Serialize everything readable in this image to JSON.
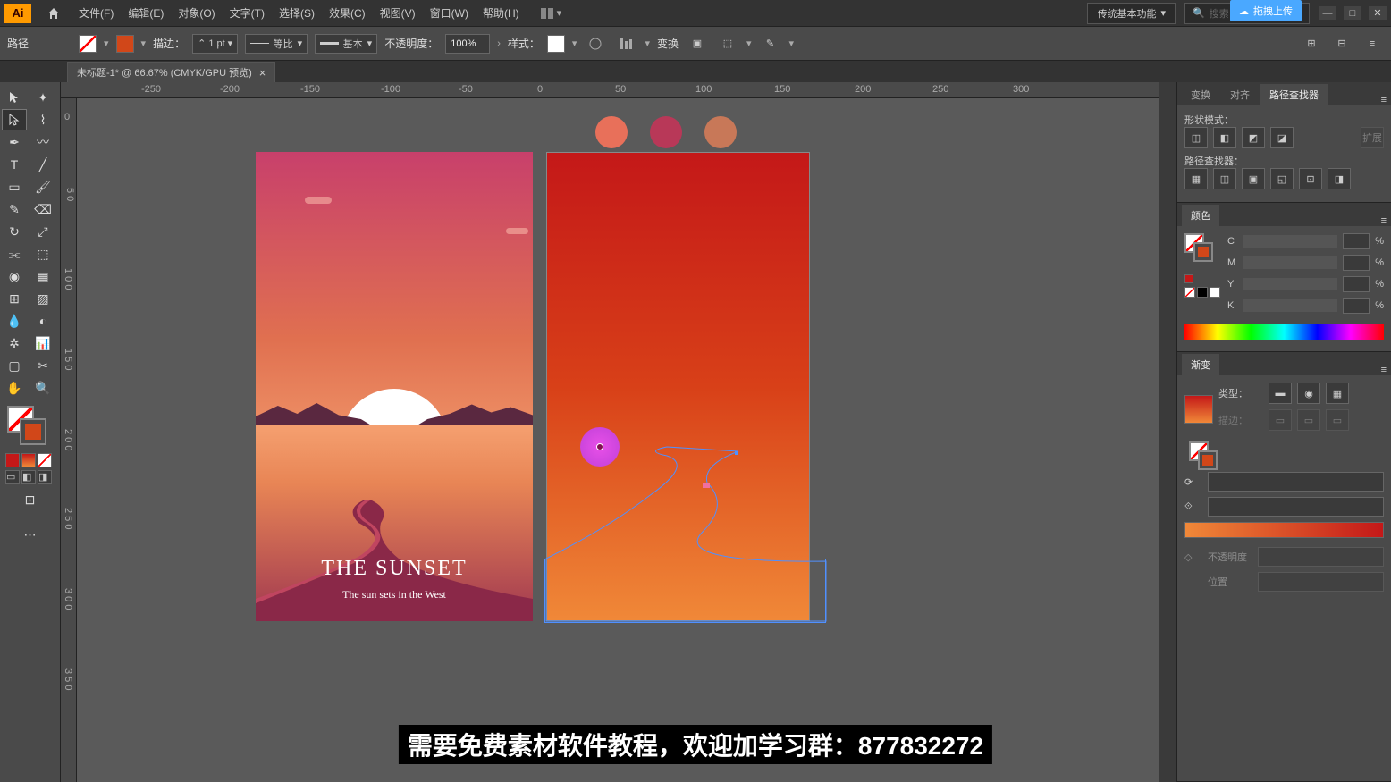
{
  "menubar": {
    "logo": "Ai",
    "items": [
      "文件(F)",
      "编辑(E)",
      "对象(O)",
      "文字(T)",
      "选择(S)",
      "效果(C)",
      "视图(V)",
      "窗口(W)",
      "帮助(H)"
    ],
    "workspace": "传统基本功能",
    "search_placeholder": "搜索 Adobe Stock",
    "upload": "拖拽上传"
  },
  "controlbar": {
    "mode": "路径",
    "stroke_label": "描边：",
    "stroke_weight": "1 pt",
    "profile1": "等比",
    "profile2": "基本",
    "opacity_label": "不透明度：",
    "opacity": "100%",
    "style_label": "样式：",
    "transform_label": "变换"
  },
  "tab": {
    "title": "未标题-1* @ 66.67% (CMYK/GPU 预览)"
  },
  "ruler": {
    "h": [
      "-250",
      "-200",
      "-150",
      "-100",
      "-50",
      "0",
      "50",
      "100",
      "150",
      "200",
      "250",
      "300"
    ],
    "v": [
      "0",
      "5 0",
      "1 0 0",
      "1 5 0",
      "2 0 0",
      "2 5 0",
      "3 0 0",
      "3 5 0"
    ]
  },
  "artboard1": {
    "title": "THE SUNSET",
    "subtitle": "The sun sets in the West"
  },
  "color_dots": [
    "#e8705a",
    "#b83858",
    "#c87858"
  ],
  "panels": {
    "align": {
      "tabs": [
        "变换",
        "对齐",
        "路径查找器"
      ],
      "shape_mode": "形状模式：",
      "pathfinder": "路径查找器："
    },
    "color": {
      "title": "颜色",
      "channels": [
        "C",
        "M",
        "Y",
        "K"
      ],
      "pct": "%"
    },
    "gradient": {
      "title": "渐变",
      "type_label": "类型：",
      "stroke_label": "描边：",
      "opacity_label": "不透明度",
      "position_label": "位置"
    }
  },
  "caption": "需要免费素材软件教程，欢迎加学习群：877832272"
}
